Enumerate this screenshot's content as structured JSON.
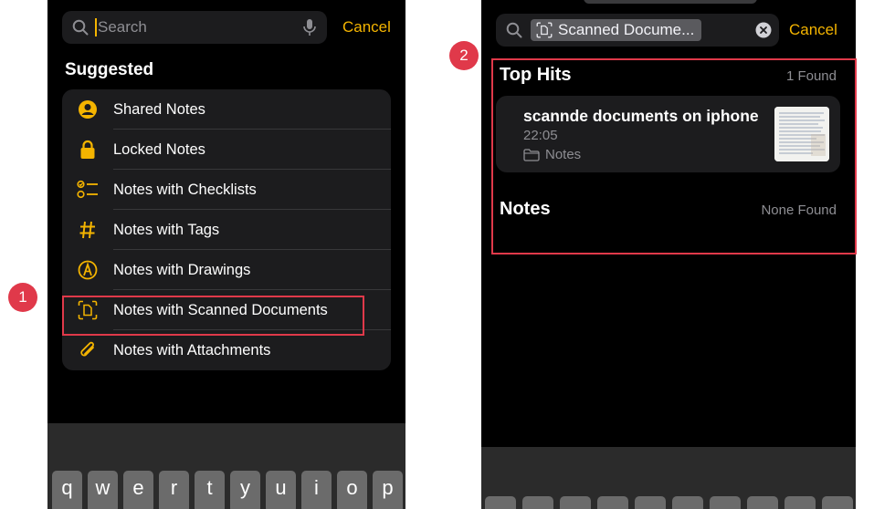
{
  "left": {
    "search_placeholder": "Search",
    "cancel_label": "Cancel",
    "suggested_title": "Suggested",
    "items": [
      {
        "label": "Shared Notes",
        "icon": "person-circle-icon"
      },
      {
        "label": "Locked Notes",
        "icon": "lock-icon"
      },
      {
        "label": "Notes with Checklists",
        "icon": "checklist-icon"
      },
      {
        "label": "Notes with Tags",
        "icon": "hashtag-icon"
      },
      {
        "label": "Notes with Drawings",
        "icon": "pencil-circle-icon"
      },
      {
        "label": "Notes with Scanned Documents",
        "icon": "scanned-document-icon"
      },
      {
        "label": "Notes with Attachments",
        "icon": "paperclip-icon"
      }
    ],
    "keys": [
      "q",
      "w",
      "e",
      "r",
      "t",
      "y",
      "u",
      "i",
      "o",
      "p"
    ],
    "step_badge": "1"
  },
  "right": {
    "search_token": "Scanned Docume...",
    "cancel_label": "Cancel",
    "top_hits_title": "Top Hits",
    "top_hits_count": "1 Found",
    "result": {
      "title": "scannde documents on iphone",
      "time": "22:05",
      "folder": "Notes"
    },
    "notes_title": "Notes",
    "notes_count": "None Found",
    "step_badge": "2"
  },
  "colors": {
    "accent": "#f4b400",
    "highlight_box": "#e0394a",
    "background": "#000000",
    "cell": "#1c1c1e"
  }
}
